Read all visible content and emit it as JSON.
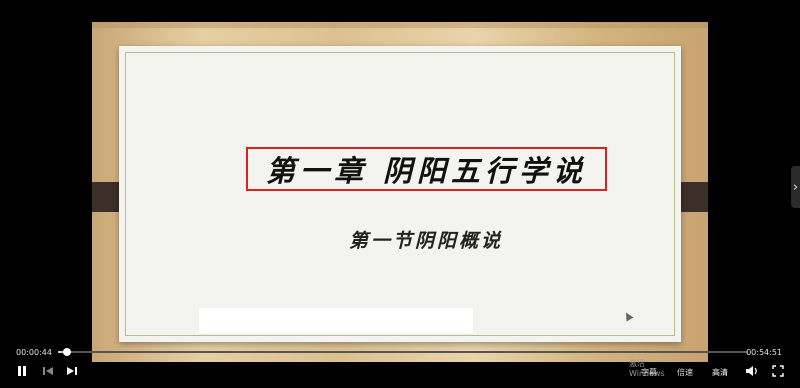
{
  "slide": {
    "title": "第一章 阴阳五行学说",
    "subtitle": "第一节阴阳概说",
    "watermark": "激活 Windows"
  },
  "player": {
    "current_time": "00:00:44",
    "duration": "00:54:51",
    "progress_fraction": 0.0134,
    "buttons": {
      "play_pause_icon": "pause-icon",
      "prev_icon": "skip-previous-icon",
      "next_icon": "skip-next-icon",
      "subtitle_label": "字幕",
      "speed_label": "倍速",
      "quality_label": "高清",
      "volume_icon": "volume-icon",
      "fullscreen_icon": "fullscreen-icon"
    },
    "side_next_glyph": "›"
  },
  "colors": {
    "title_border": "#d9211d",
    "background": "#000000"
  }
}
